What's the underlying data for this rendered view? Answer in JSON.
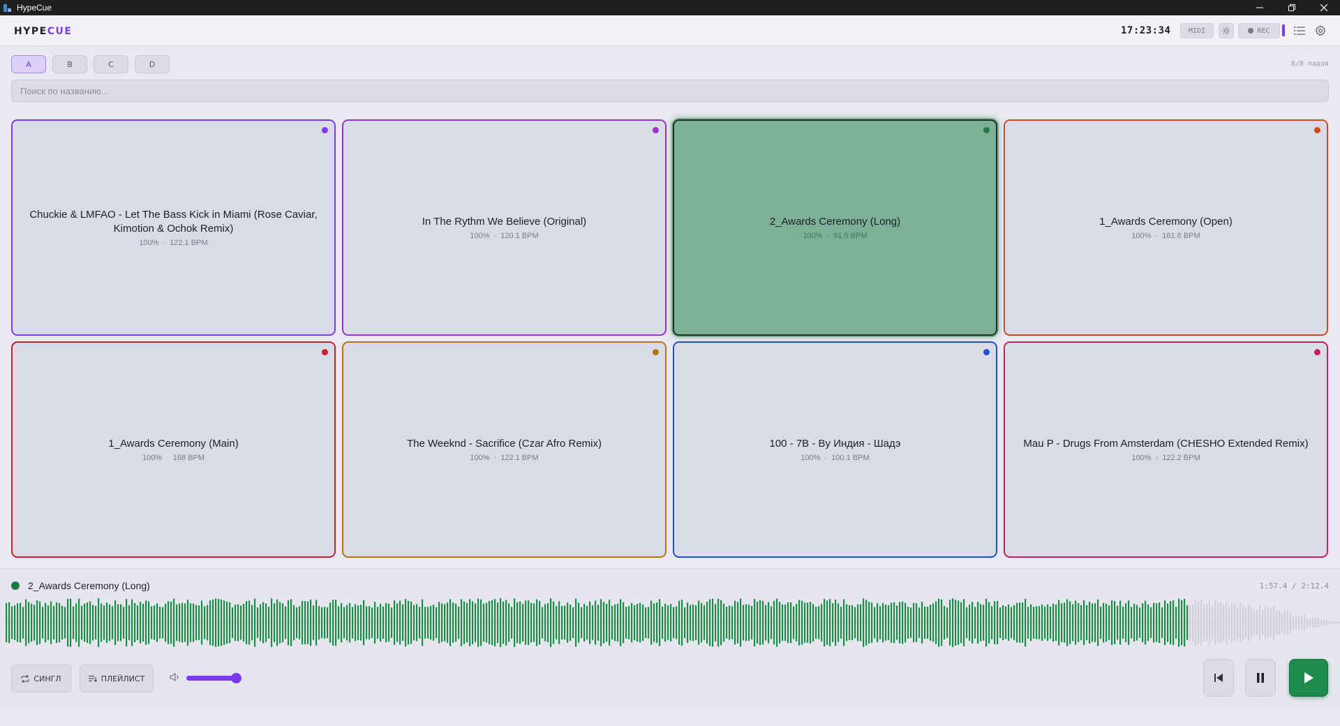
{
  "window": {
    "title": "HypeCue"
  },
  "header": {
    "logo_part1": "HYPE",
    "logo_part2": "CUE",
    "clock": "17:23:34",
    "midi_label": "MIDI",
    "rec_label": "REC"
  },
  "banks": {
    "tabs": [
      "A",
      "B",
      "C",
      "D"
    ],
    "active": "A",
    "pad_count": "8/8 падов"
  },
  "search": {
    "placeholder": "Поиск по названию..."
  },
  "pads": [
    {
      "title": "Chuckie & LMFAO - Let The Bass Kick in Miami (Rose Caviar, Kimotion & Ochok Remix)",
      "volume": "100%",
      "bpm": "122.1 BPM",
      "color": "#7c3aed",
      "playing": false
    },
    {
      "title": "In The Rythm We Believe (Original)",
      "volume": "100%",
      "bpm": "120.1 BPM",
      "color": "#9b30d0",
      "playing": false
    },
    {
      "title": "2_Awards Ceremony (Long)",
      "volume": "100%",
      "bpm": "91.5 BPM",
      "color": "#1e7a44",
      "playing": true
    },
    {
      "title": "1_Awards Ceremony (Open)",
      "volume": "100%",
      "bpm": "161.6 BPM",
      "color": "#d14a1c",
      "playing": false
    },
    {
      "title": "1_Awards Ceremony (Main)",
      "volume": "100%",
      "bpm": "168 BPM",
      "color": "#c8202e",
      "playing": false
    },
    {
      "title": "The Weeknd - Sacrifice (Czar Afro Remix)",
      "volume": "100%",
      "bpm": "122.1 BPM",
      "color": "#b8720c",
      "playing": false
    },
    {
      "title": "100 - 7B - By Индия - Шадэ",
      "volume": "100%",
      "bpm": "100.1 BPM",
      "color": "#1e4fd8",
      "playing": false
    },
    {
      "title": "Mau P - Drugs From Amsterdam (CHESHO Extended Remix)",
      "volume": "100%",
      "bpm": "122.2 BPM",
      "color": "#c81e5a",
      "playing": false
    }
  ],
  "player": {
    "now_playing": "2_Awards Ceremony (Long)",
    "time": "1:57.4 / 2:12.4",
    "progress": 0.887,
    "played_color": "#1e8a4c",
    "unplayed_color": "#cfd0dc",
    "single_label": "СИНГЛ",
    "playlist_label": "ПЛЕЙЛИСТ",
    "volume": 0.85
  },
  "colors": {
    "accent": "#7c3aed",
    "playing": "#7db196"
  },
  "icons": [
    "app-icon",
    "minimize-icon",
    "restore-icon",
    "close-icon",
    "sun-icon",
    "list-icon",
    "gear-icon",
    "repeat-icon",
    "playlist-icon",
    "volume-icon",
    "skip-previous-icon",
    "pause-icon",
    "play-icon"
  ]
}
